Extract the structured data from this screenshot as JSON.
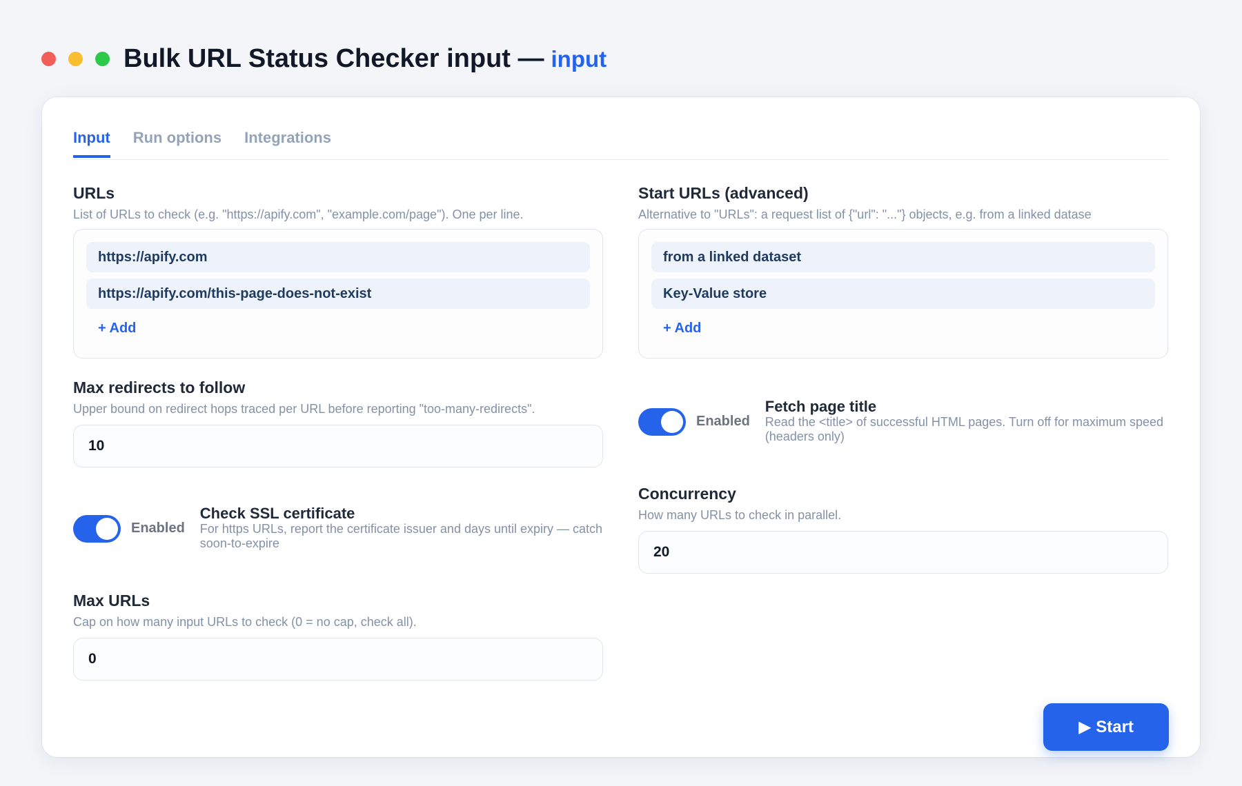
{
  "window": {
    "title": "Bulk URL Status Checker input —",
    "subtitle": "input",
    "dots": [
      "#f25f58",
      "#f9bd30",
      "#2fc94a"
    ]
  },
  "tabs": [
    {
      "label": "Input",
      "active": true
    },
    {
      "label": "Run options",
      "active": false
    },
    {
      "label": "Integrations",
      "active": false
    }
  ],
  "urls": {
    "label": "URLs",
    "description": "List of URLs to check (e.g. \"https://apify.com\", \"example.com/page\"). One per line.",
    "items": [
      "https://apify.com",
      "https://apify.com/this-page-does-not-exist"
    ],
    "add_label": "+ Add"
  },
  "start_urls": {
    "label": "Start URLs (advanced)",
    "description": "Alternative to \"URLs\": a request list of {\"url\": \"...\"} objects, e.g. from a linked datase",
    "items": [
      "from a linked dataset",
      "Key-Value store"
    ],
    "add_label": "+ Add"
  },
  "max_redirects": {
    "label": "Max redirects to follow",
    "description": "Upper bound on redirect hops traced per URL before reporting \"too-many-redirects\".",
    "value": "10"
  },
  "fetch_title": {
    "status": "Enabled",
    "label": "Fetch page title",
    "description": "Read the <title> of successful HTML pages. Turn off for maximum speed (headers only)",
    "enabled": true
  },
  "check_ssl": {
    "status": "Enabled",
    "label": "Check SSL certificate",
    "description": "For https URLs, report the certificate issuer and days until expiry — catch soon-to-expire",
    "enabled": true
  },
  "concurrency": {
    "label": "Concurrency",
    "description": "How many URLs to check in parallel.",
    "value": "20"
  },
  "max_urls": {
    "label": "Max URLs",
    "description": "Cap on how many input URLs to check (0 = no cap, check all).",
    "value": "0"
  },
  "start_button": {
    "label": "▶ Start"
  },
  "colors": {
    "accent": "#2563eb",
    "background": "#f3f5f9"
  }
}
